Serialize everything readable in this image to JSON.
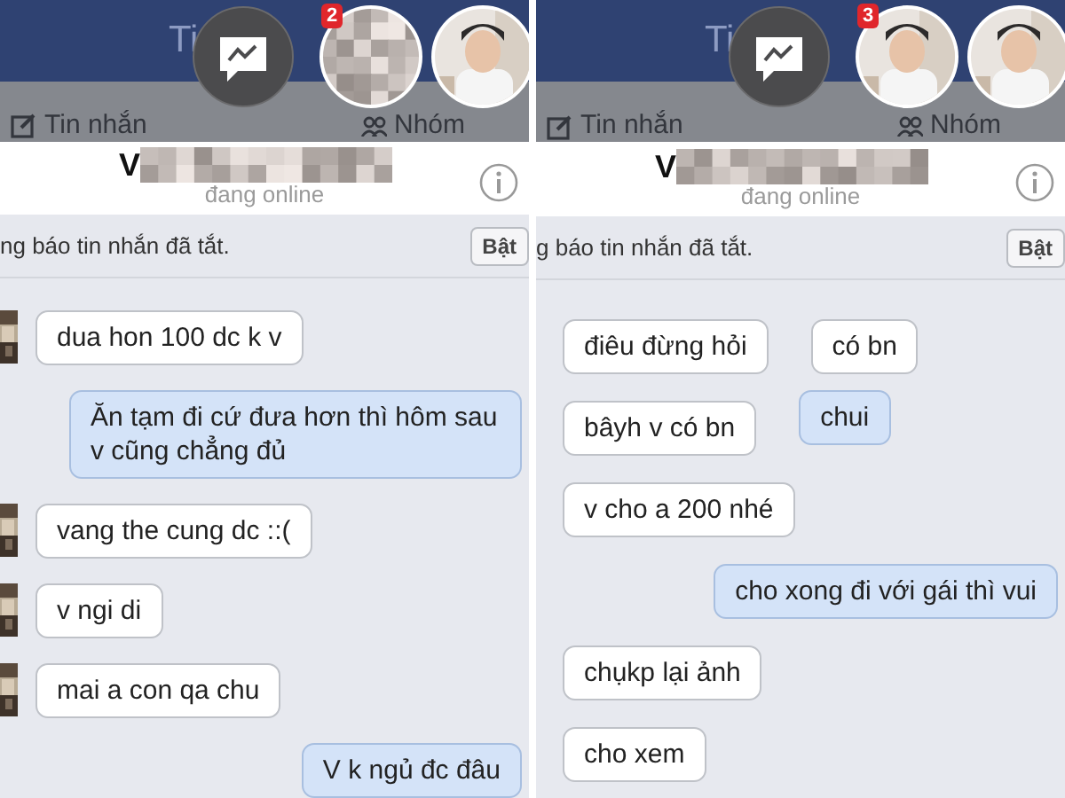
{
  "panels": [
    {
      "title_fragment": "Ti",
      "tabs": [
        {
          "label": "Tin nhắn",
          "kind": "compose"
        },
        {
          "label": "Nhóm",
          "kind": "group"
        }
      ],
      "chat_heads": {
        "badge": "2",
        "first_avatar_blurred": true
      },
      "contact": {
        "name": "V",
        "status": "đang online"
      },
      "notice": {
        "text": "ng báo tin nhắn đã tắt.",
        "button": "Bật"
      },
      "rows": [
        {
          "items": [
            {
              "kind": "incoming",
              "text": "dua hon 100 dc k v",
              "avatar": true
            }
          ]
        },
        {
          "items": [
            {
              "kind": "outgoing",
              "text": "Ăn tạm đi cứ đưa hơn thì hôm sau v cũng chẳng đủ"
            }
          ]
        },
        {
          "items": [
            {
              "kind": "incoming",
              "text": "vang the cung dc ::(",
              "avatar": true
            }
          ]
        },
        {
          "items": [
            {
              "kind": "incoming",
              "text": "v ngi di",
              "avatar": true
            }
          ]
        },
        {
          "items": [
            {
              "kind": "incoming",
              "text": "mai a con qa chu",
              "avatar": true
            }
          ]
        },
        {
          "items": [
            {
              "kind": "outgoing",
              "text": "V k ngủ đc đâu"
            }
          ]
        }
      ]
    },
    {
      "title_fragment": "Ti",
      "tabs": [
        {
          "label": "Tin nhắn",
          "kind": "compose"
        },
        {
          "label": "Nhóm",
          "kind": "group"
        }
      ],
      "chat_heads": {
        "badge": "3",
        "first_avatar_blurred": false
      },
      "contact": {
        "name": "V",
        "status": "đang online"
      },
      "notice": {
        "text": "g báo tin nhắn đã tắt.",
        "button": "Bật"
      },
      "rows": [
        {
          "items": [
            {
              "kind": "incoming",
              "text": "điêu đừng hỏi"
            },
            {
              "kind": "incoming",
              "text": "có bn"
            }
          ]
        },
        {
          "items": [
            {
              "kind": "incoming",
              "text": "bâyh v có bn"
            },
            {
              "kind": "outgoing",
              "text": "chui"
            }
          ]
        },
        {
          "items": [
            {
              "kind": "incoming",
              "text": "v cho a 200 nhé"
            }
          ]
        },
        {
          "items": [
            {
              "kind": "outgoing",
              "text": "cho xong đi với gái thì vui"
            }
          ]
        },
        {
          "items": [
            {
              "kind": "incoming",
              "text": "chụkp lại ảnh"
            }
          ]
        },
        {
          "items": [
            {
              "kind": "incoming",
              "text": "cho xem"
            }
          ]
        }
      ]
    }
  ]
}
